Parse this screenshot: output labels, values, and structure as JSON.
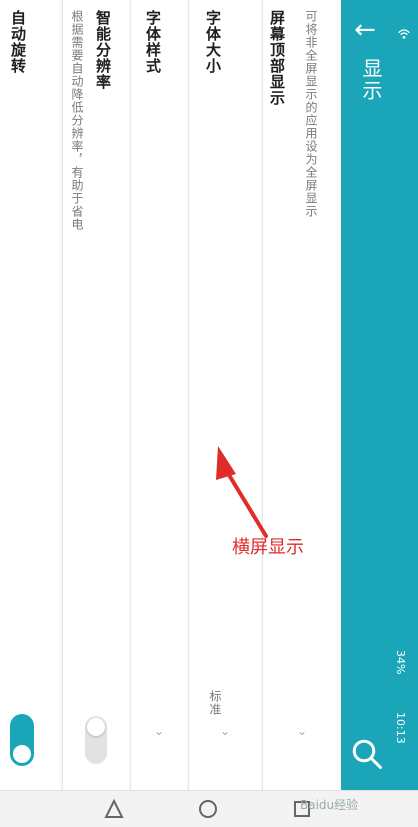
{
  "appbar": {
    "title": "显示",
    "back_icon": "arrow-left-icon",
    "search_icon": "search-icon",
    "color": "#1aa6b8"
  },
  "status": {
    "battery": "34%",
    "time": "10:13"
  },
  "settings": {
    "screen_top": {
      "title": "屏幕顶部显示",
      "subtitle": "可将非全屏显示的应用设为全屏显示"
    },
    "font_size": {
      "title": "字体大小",
      "value": "标准"
    },
    "font_style": {
      "title": "字体样式"
    },
    "smart_resolution": {
      "title": "智能分辨率",
      "subtitle": "根据需要自动降低分辨率，有助于省电",
      "enabled": false
    },
    "auto_rotate": {
      "title": "自动旋转",
      "enabled": true
    }
  },
  "annotation": {
    "text": "横屏显示",
    "color": "#e02b2b"
  },
  "watermark": "Baidu经验"
}
